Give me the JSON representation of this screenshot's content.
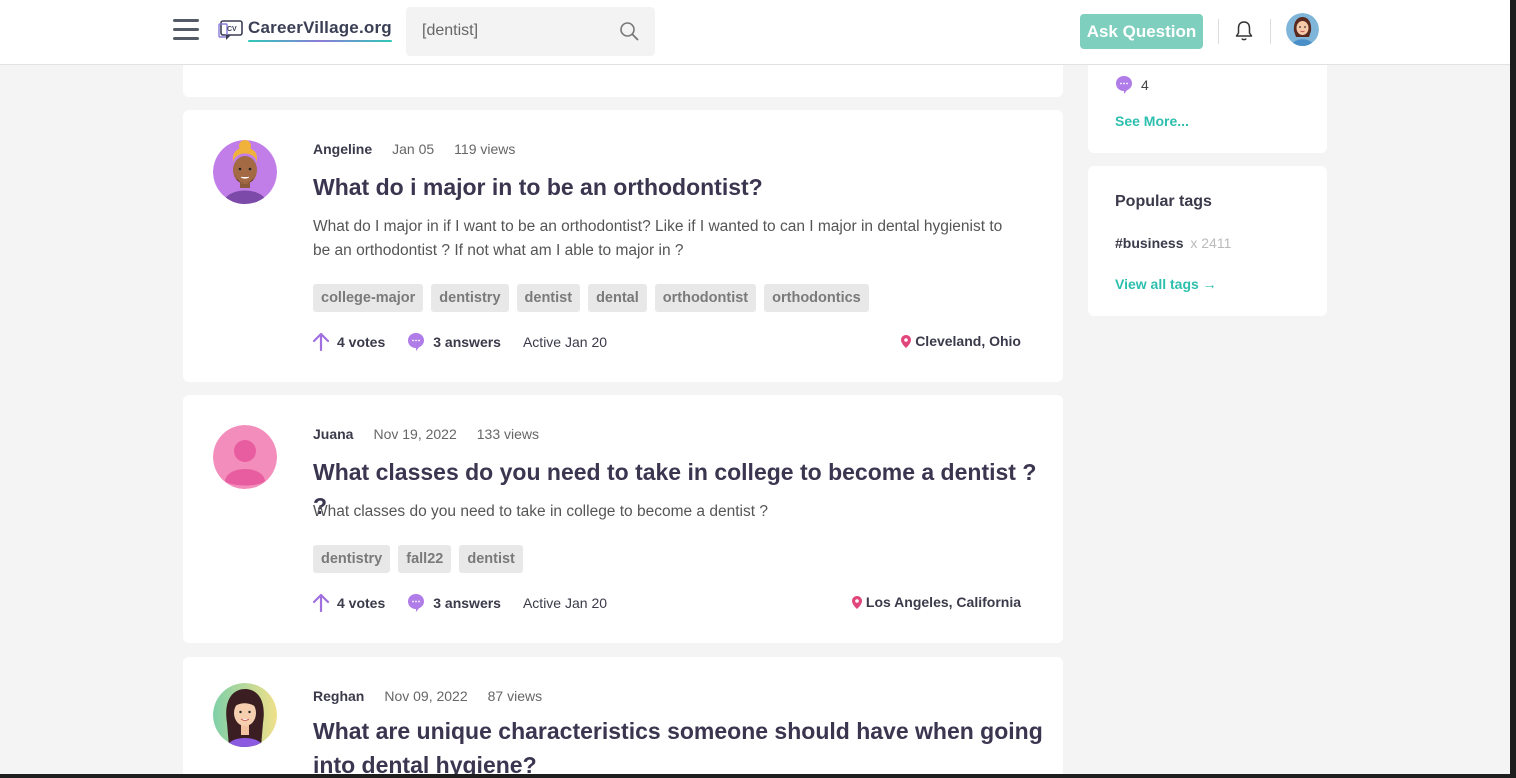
{
  "header": {
    "logo_text": "CareerVillage.org",
    "logo_mark_text": "CV",
    "search_value": "[dentist]",
    "ask_label": "Ask Question"
  },
  "sidebar": {
    "answer_count": "4",
    "see_more_label": "See More...",
    "popular_title": "Popular tags",
    "tag_name": "#business",
    "tag_count": "x 2411",
    "view_all_label": "View all tags →"
  },
  "questions": [
    {
      "author": "Angeline",
      "date": "Jan 05",
      "views": "119 views",
      "title": "What do i major in to be an orthodontist?",
      "body": "What do I major in if I want to be an orthodontist? Like if I wanted to can I major in dental hygienist to be an orthodontist ? If not what am I able to major in ?",
      "tags": [
        "college-major",
        "dentistry",
        "dentist",
        "dental",
        "orthodontist",
        "orthodontics"
      ],
      "votes": "4 votes",
      "answers": "3 answers",
      "active": "Active Jan 20",
      "location": "Cleveland, Ohio"
    },
    {
      "author": "Juana",
      "date": "Nov 19, 2022",
      "views": "133 views",
      "title": "What classes do you need to take in college to become a dentist ? ?",
      "body": "What classes do you need to take in college to become a dentist ?",
      "tags": [
        "dentistry",
        "fall22",
        "dentist"
      ],
      "votes": "4 votes",
      "answers": "3 answers",
      "active": "Active Jan 20",
      "location": "Los Angeles, California"
    },
    {
      "author": "Reghan",
      "date": "Nov 09, 2022",
      "views": "87 views",
      "title": "What are unique characteristics someone should have when going into dental hygiene?"
    }
  ],
  "colors": {
    "accent": "#2dbfad",
    "ask_button": "#7fcfbf",
    "bubble": "#b07ce8",
    "upvote": "#a070e0",
    "pin": "#e0457b"
  }
}
